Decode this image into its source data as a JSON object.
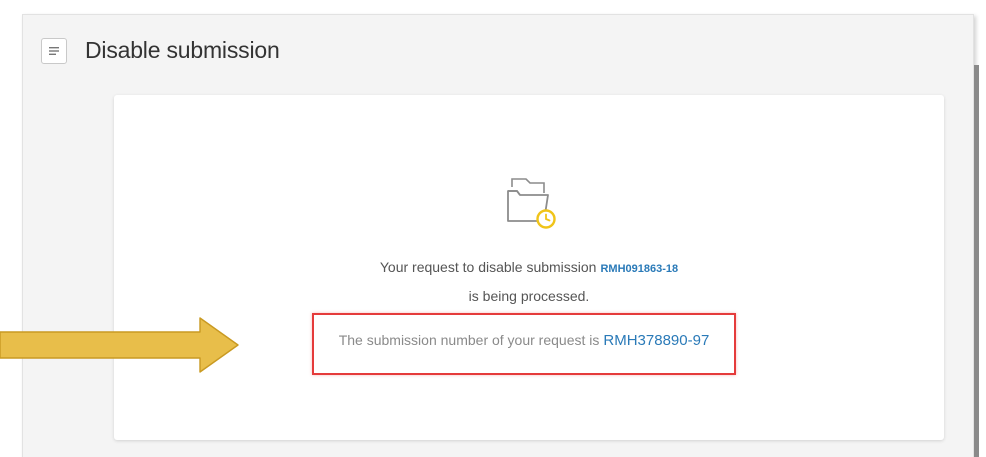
{
  "header": {
    "title": "Disable submission",
    "menu_icon": "hamburger-menu-icon"
  },
  "card": {
    "icon": "folder-pending-icon",
    "message_prefix": "Your request to disable submission",
    "reference_number": "RMH091863-18",
    "message_suffix": "is being processed.",
    "submission_prefix": "The submission number of your request is",
    "submission_number": "RMH378890-97"
  },
  "annotation": {
    "arrow_color": "#e8be4a",
    "highlight_color": "#e53b3b"
  },
  "colors": {
    "link_blue": "#2a7ab8",
    "icon_accent": "#f0c419"
  }
}
